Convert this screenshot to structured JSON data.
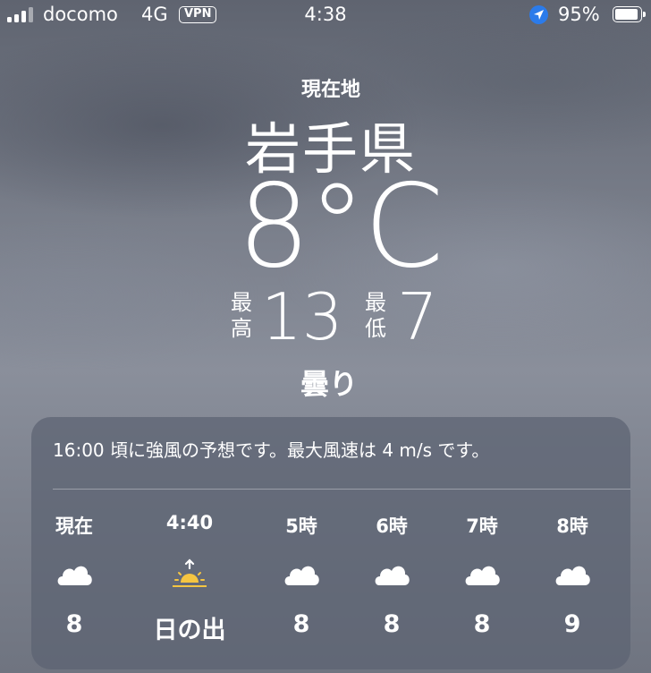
{
  "status_bar": {
    "carrier": "docomo",
    "network": "4G",
    "vpn": "VPN",
    "time": "4:38",
    "battery_percent": "95%",
    "battery_level": 0.95,
    "signal_bars": 3,
    "signal_bars_total": 4
  },
  "weather": {
    "location_label": "現在地",
    "city": "岩手県",
    "temperature": "8°C",
    "high_label": "最高",
    "high": "13",
    "low_label": "最低",
    "low": "7",
    "condition": "曇り"
  },
  "forecast_card": {
    "summary": "16:00 頃に強風の予想です。最大風速は 4 m/s です。",
    "hours": [
      {
        "label": "現在",
        "icon": "cloud-icon",
        "value": "8"
      },
      {
        "label": "4:40",
        "icon": "sunrise-icon",
        "value": "日の出"
      },
      {
        "label": "5時",
        "icon": "cloud-icon",
        "value": "8"
      },
      {
        "label": "6時",
        "icon": "cloud-icon",
        "value": "8"
      },
      {
        "label": "7時",
        "icon": "cloud-icon",
        "value": "8"
      },
      {
        "label": "8時",
        "icon": "cloud-icon",
        "value": "9"
      }
    ]
  },
  "colors": {
    "sunrise": "#f5c542",
    "location_arrow_bg": "#2b7bea"
  }
}
